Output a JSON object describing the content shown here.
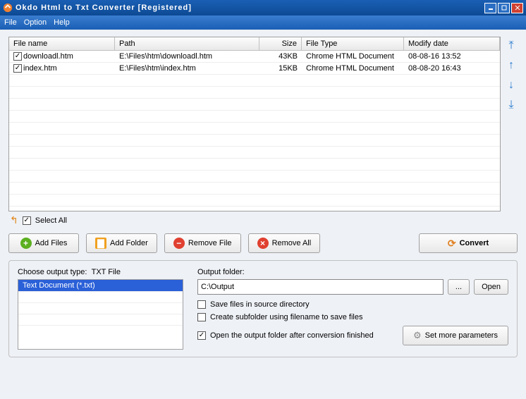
{
  "title": "Okdo Html to Txt Converter [Registered]",
  "menu": {
    "file": "File",
    "option": "Option",
    "help": "Help"
  },
  "columns": {
    "name": "File name",
    "path": "Path",
    "size": "Size",
    "type": "File Type",
    "date": "Modify date"
  },
  "rows": [
    {
      "checked": true,
      "name": "downloadl.htm",
      "path": "E:\\Files\\htm\\downloadl.htm",
      "size": "43KB",
      "type": "Chrome HTML Document",
      "date": "08-08-16 13:52"
    },
    {
      "checked": true,
      "name": "index.htm",
      "path": "E:\\Files\\htm\\index.htm",
      "size": "15KB",
      "type": "Chrome HTML Document",
      "date": "08-08-20 16:43"
    }
  ],
  "selectall": "Select All",
  "buttons": {
    "addfiles": "Add Files",
    "addfolder": "Add Folder",
    "removefile": "Remove File",
    "removeall": "Remove All",
    "convert": "Convert"
  },
  "output": {
    "typelabel": "Choose output type:",
    "typevalue": "TXT File",
    "typeitem": "Text Document (*.txt)",
    "folderlabel": "Output folder:",
    "folderpath": "C:\\Output",
    "browse": "...",
    "open": "Open",
    "save_source": "Save files in source directory",
    "create_sub": "Create subfolder using filename to save files",
    "open_after": "Open the output folder after conversion finished",
    "more": "Set more parameters"
  },
  "checks": {
    "save_source": false,
    "create_sub": false,
    "open_after": true
  }
}
